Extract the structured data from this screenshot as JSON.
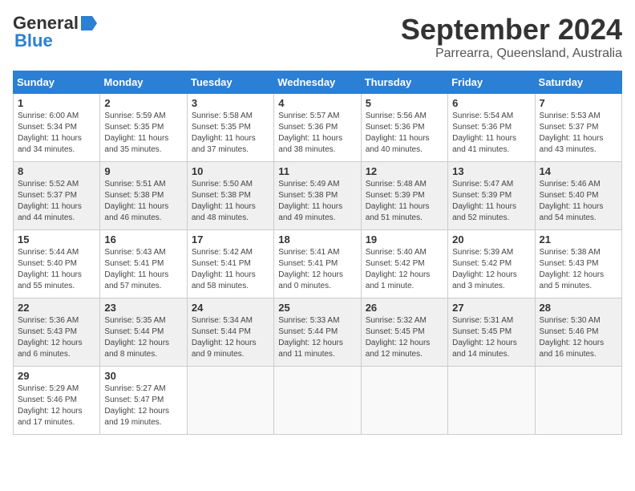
{
  "header": {
    "logo_general": "General",
    "logo_blue": "Blue",
    "month_title": "September 2024",
    "subtitle": "Parrearra, Queensland, Australia"
  },
  "days_of_week": [
    "Sunday",
    "Monday",
    "Tuesday",
    "Wednesday",
    "Thursday",
    "Friday",
    "Saturday"
  ],
  "weeks": [
    [
      {
        "day": "1",
        "info": "Sunrise: 6:00 AM\nSunset: 5:34 PM\nDaylight: 11 hours\nand 34 minutes."
      },
      {
        "day": "2",
        "info": "Sunrise: 5:59 AM\nSunset: 5:35 PM\nDaylight: 11 hours\nand 35 minutes."
      },
      {
        "day": "3",
        "info": "Sunrise: 5:58 AM\nSunset: 5:35 PM\nDaylight: 11 hours\nand 37 minutes."
      },
      {
        "day": "4",
        "info": "Sunrise: 5:57 AM\nSunset: 5:36 PM\nDaylight: 11 hours\nand 38 minutes."
      },
      {
        "day": "5",
        "info": "Sunrise: 5:56 AM\nSunset: 5:36 PM\nDaylight: 11 hours\nand 40 minutes."
      },
      {
        "day": "6",
        "info": "Sunrise: 5:54 AM\nSunset: 5:36 PM\nDaylight: 11 hours\nand 41 minutes."
      },
      {
        "day": "7",
        "info": "Sunrise: 5:53 AM\nSunset: 5:37 PM\nDaylight: 11 hours\nand 43 minutes."
      }
    ],
    [
      {
        "day": "8",
        "info": "Sunrise: 5:52 AM\nSunset: 5:37 PM\nDaylight: 11 hours\nand 44 minutes."
      },
      {
        "day": "9",
        "info": "Sunrise: 5:51 AM\nSunset: 5:38 PM\nDaylight: 11 hours\nand 46 minutes."
      },
      {
        "day": "10",
        "info": "Sunrise: 5:50 AM\nSunset: 5:38 PM\nDaylight: 11 hours\nand 48 minutes."
      },
      {
        "day": "11",
        "info": "Sunrise: 5:49 AM\nSunset: 5:38 PM\nDaylight: 11 hours\nand 49 minutes."
      },
      {
        "day": "12",
        "info": "Sunrise: 5:48 AM\nSunset: 5:39 PM\nDaylight: 11 hours\nand 51 minutes."
      },
      {
        "day": "13",
        "info": "Sunrise: 5:47 AM\nSunset: 5:39 PM\nDaylight: 11 hours\nand 52 minutes."
      },
      {
        "day": "14",
        "info": "Sunrise: 5:46 AM\nSunset: 5:40 PM\nDaylight: 11 hours\nand 54 minutes."
      }
    ],
    [
      {
        "day": "15",
        "info": "Sunrise: 5:44 AM\nSunset: 5:40 PM\nDaylight: 11 hours\nand 55 minutes."
      },
      {
        "day": "16",
        "info": "Sunrise: 5:43 AM\nSunset: 5:41 PM\nDaylight: 11 hours\nand 57 minutes."
      },
      {
        "day": "17",
        "info": "Sunrise: 5:42 AM\nSunset: 5:41 PM\nDaylight: 11 hours\nand 58 minutes."
      },
      {
        "day": "18",
        "info": "Sunrise: 5:41 AM\nSunset: 5:41 PM\nDaylight: 12 hours\nand 0 minutes."
      },
      {
        "day": "19",
        "info": "Sunrise: 5:40 AM\nSunset: 5:42 PM\nDaylight: 12 hours\nand 1 minute."
      },
      {
        "day": "20",
        "info": "Sunrise: 5:39 AM\nSunset: 5:42 PM\nDaylight: 12 hours\nand 3 minutes."
      },
      {
        "day": "21",
        "info": "Sunrise: 5:38 AM\nSunset: 5:43 PM\nDaylight: 12 hours\nand 5 minutes."
      }
    ],
    [
      {
        "day": "22",
        "info": "Sunrise: 5:36 AM\nSunset: 5:43 PM\nDaylight: 12 hours\nand 6 minutes."
      },
      {
        "day": "23",
        "info": "Sunrise: 5:35 AM\nSunset: 5:44 PM\nDaylight: 12 hours\nand 8 minutes."
      },
      {
        "day": "24",
        "info": "Sunrise: 5:34 AM\nSunset: 5:44 PM\nDaylight: 12 hours\nand 9 minutes."
      },
      {
        "day": "25",
        "info": "Sunrise: 5:33 AM\nSunset: 5:44 PM\nDaylight: 12 hours\nand 11 minutes."
      },
      {
        "day": "26",
        "info": "Sunrise: 5:32 AM\nSunset: 5:45 PM\nDaylight: 12 hours\nand 12 minutes."
      },
      {
        "day": "27",
        "info": "Sunrise: 5:31 AM\nSunset: 5:45 PM\nDaylight: 12 hours\nand 14 minutes."
      },
      {
        "day": "28",
        "info": "Sunrise: 5:30 AM\nSunset: 5:46 PM\nDaylight: 12 hours\nand 16 minutes."
      }
    ],
    [
      {
        "day": "29",
        "info": "Sunrise: 5:29 AM\nSunset: 5:46 PM\nDaylight: 12 hours\nand 17 minutes."
      },
      {
        "day": "30",
        "info": "Sunrise: 5:27 AM\nSunset: 5:47 PM\nDaylight: 12 hours\nand 19 minutes."
      },
      {
        "day": "",
        "info": ""
      },
      {
        "day": "",
        "info": ""
      },
      {
        "day": "",
        "info": ""
      },
      {
        "day": "",
        "info": ""
      },
      {
        "day": "",
        "info": ""
      }
    ]
  ]
}
